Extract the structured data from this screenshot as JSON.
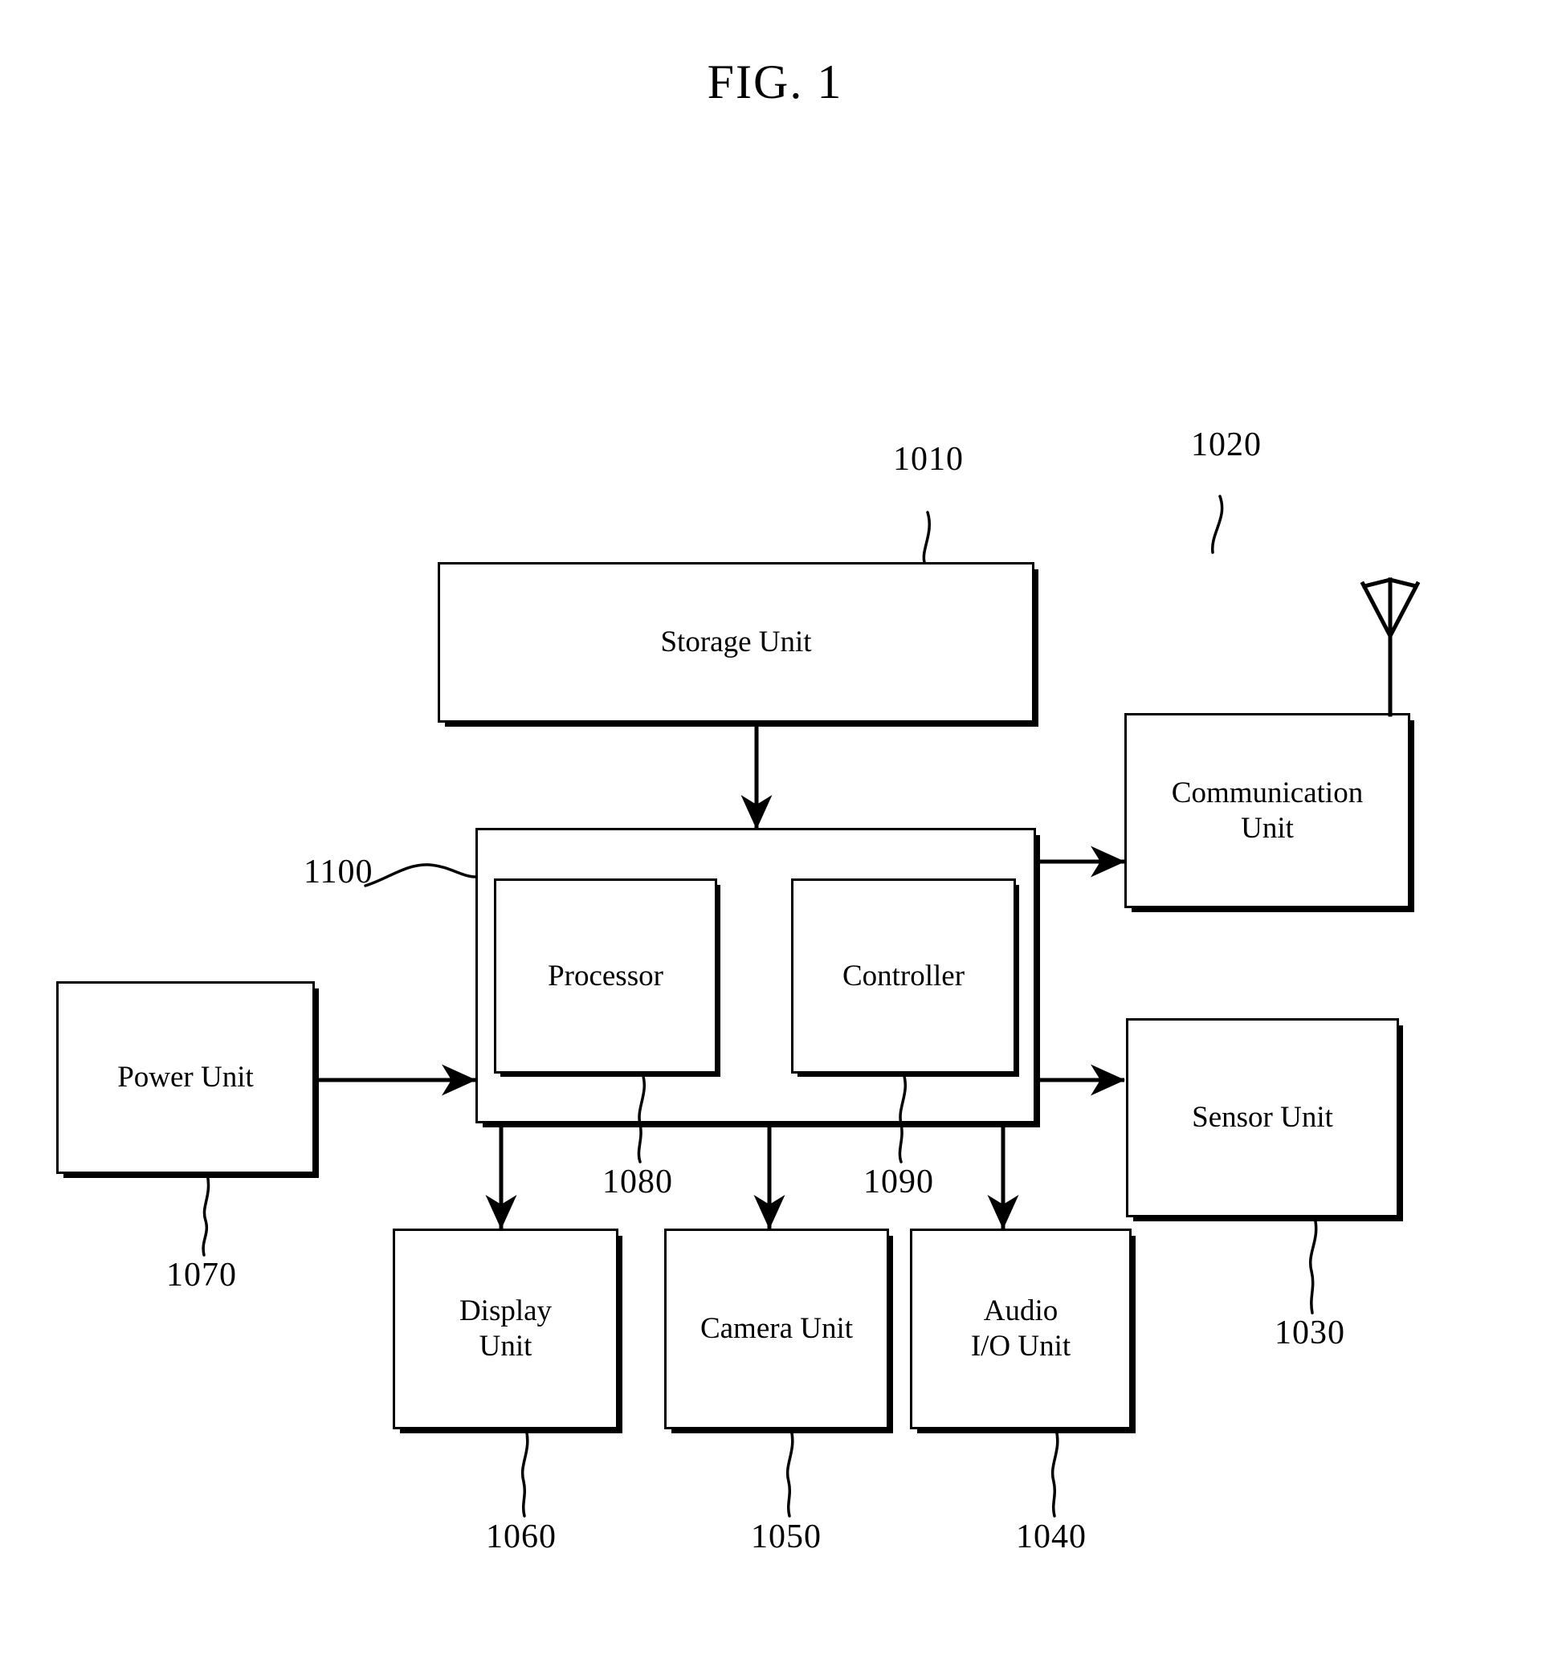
{
  "figure": {
    "title": "FIG. 1"
  },
  "blocks": {
    "storage": {
      "label": "Storage Unit",
      "ref": "1010"
    },
    "communication": {
      "label": "Communication\nUnit",
      "ref": "1020"
    },
    "sensor": {
      "label": "Sensor Unit",
      "ref": "1030"
    },
    "audio": {
      "label": "Audio\nI/O Unit",
      "ref": "1040"
    },
    "camera": {
      "label": "Camera Unit",
      "ref": "1050"
    },
    "display": {
      "label": "Display\nUnit",
      "ref": "1060"
    },
    "power": {
      "label": "Power Unit",
      "ref": "1070"
    },
    "processor": {
      "label": "Processor",
      "ref": "1080"
    },
    "controller": {
      "label": "Controller",
      "ref": "1090"
    },
    "main": {
      "label": "",
      "ref": "1100"
    }
  },
  "icons": {
    "antenna": "antenna-icon"
  },
  "style": {
    "line_color": "#000000",
    "background": "#ffffff"
  }
}
